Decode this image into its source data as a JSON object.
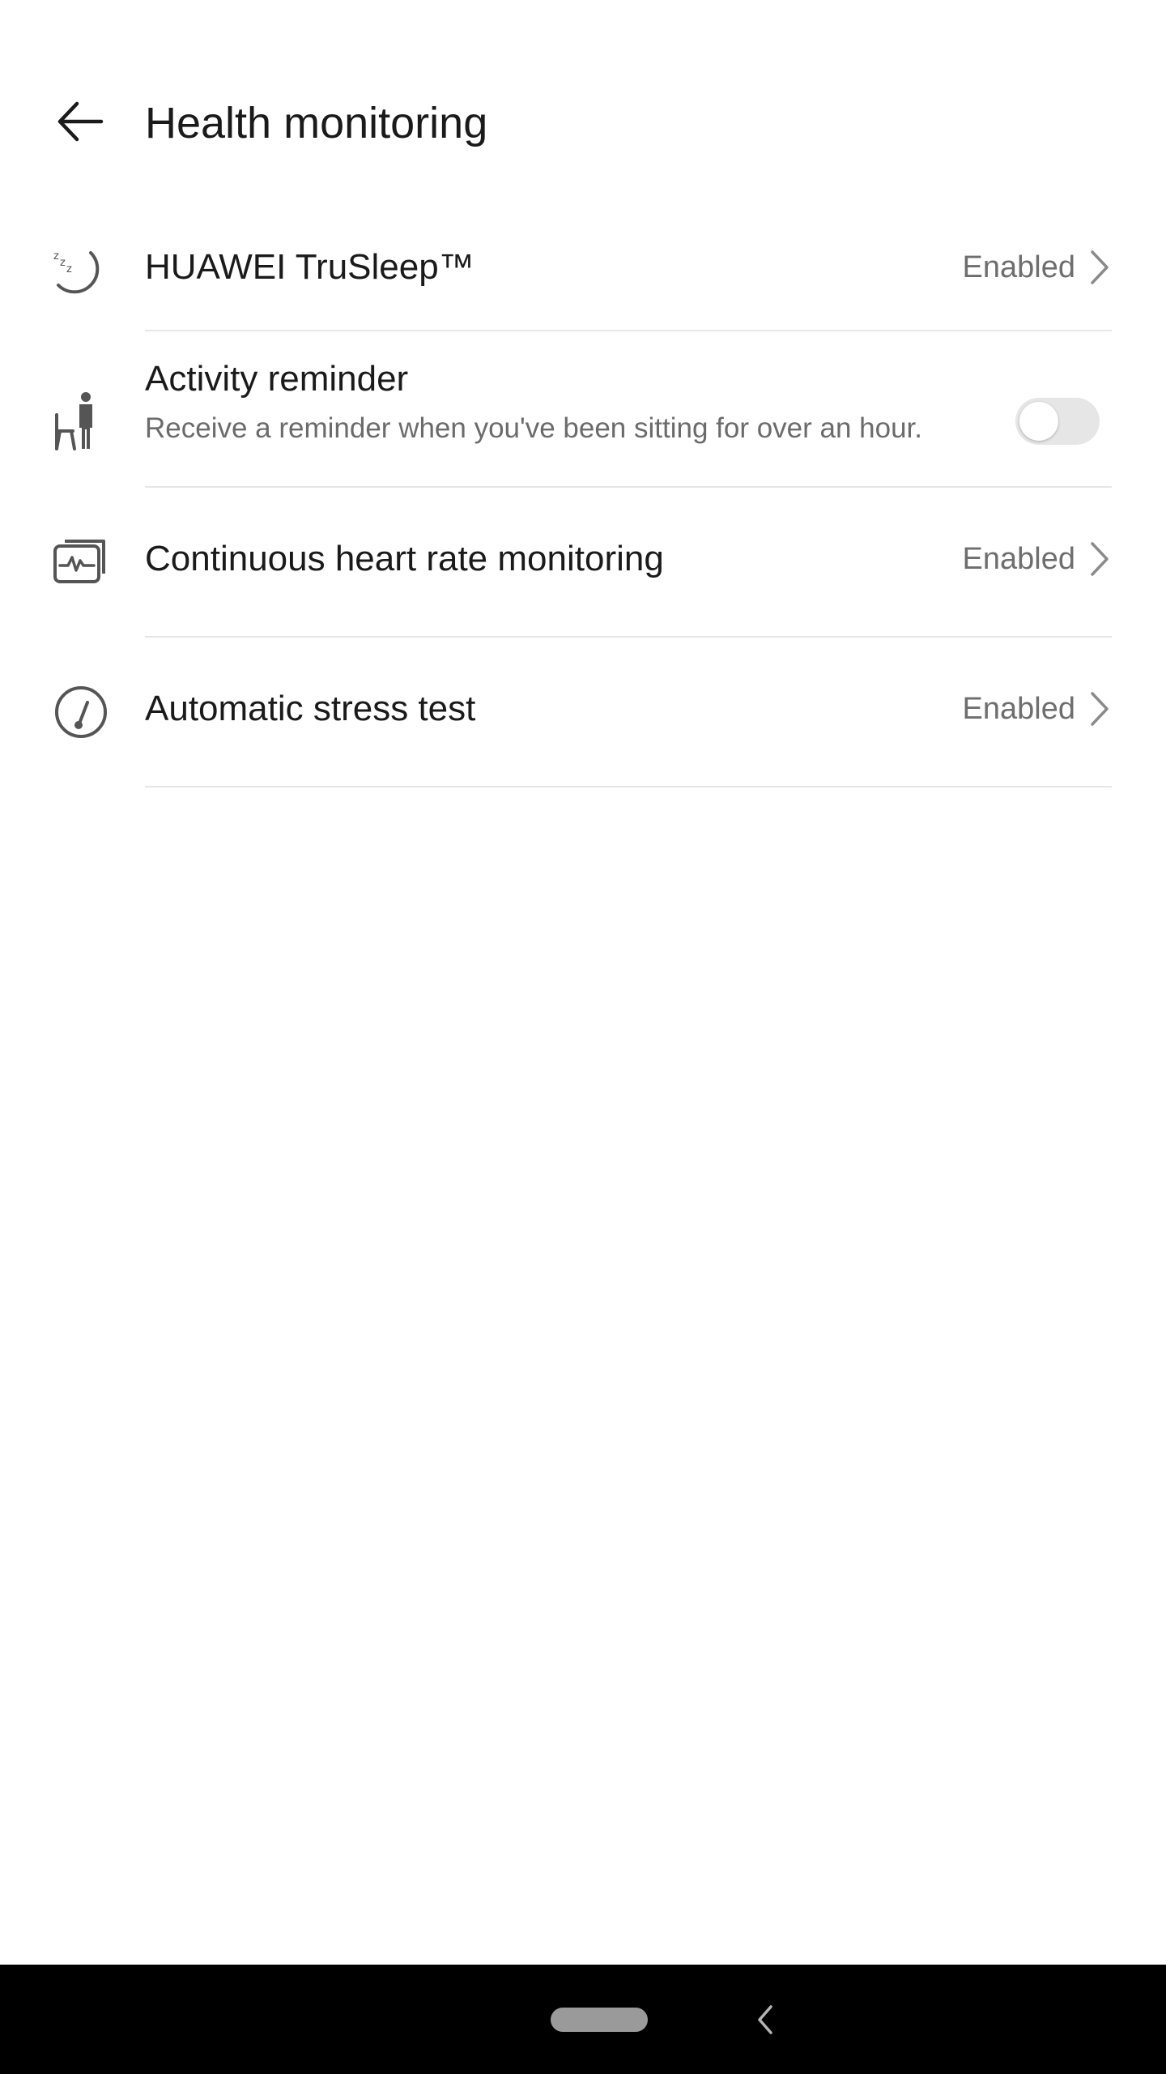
{
  "header": {
    "title": "Health monitoring",
    "back_icon": "arrow-left-icon"
  },
  "settings": {
    "trusleep": {
      "icon": "sleep-moon-icon",
      "title": "HUAWEI TruSleep™",
      "status": "Enabled"
    },
    "activity_reminder": {
      "icon": "sitting-person-icon",
      "title": "Activity reminder",
      "subtitle": "Receive a reminder when you've been sitting for over an hour.",
      "toggle_on": false
    },
    "heart_rate": {
      "icon": "heart-rate-monitor-icon",
      "title": "Continuous heart rate monitoring",
      "status": "Enabled"
    },
    "stress_test": {
      "icon": "gauge-icon",
      "title": "Automatic stress test",
      "status": "Enabled"
    }
  },
  "nav_bar": {
    "home_icon": "home-pill-icon",
    "back_icon": "nav-back-icon"
  },
  "colors": {
    "background": "#ffffff",
    "primary_text": "#1a1a1a",
    "secondary_text": "#6e6e6e",
    "divider": "#e6e6e6",
    "toggle_off": "#e6e6e6",
    "nav_bar": "#000000"
  }
}
